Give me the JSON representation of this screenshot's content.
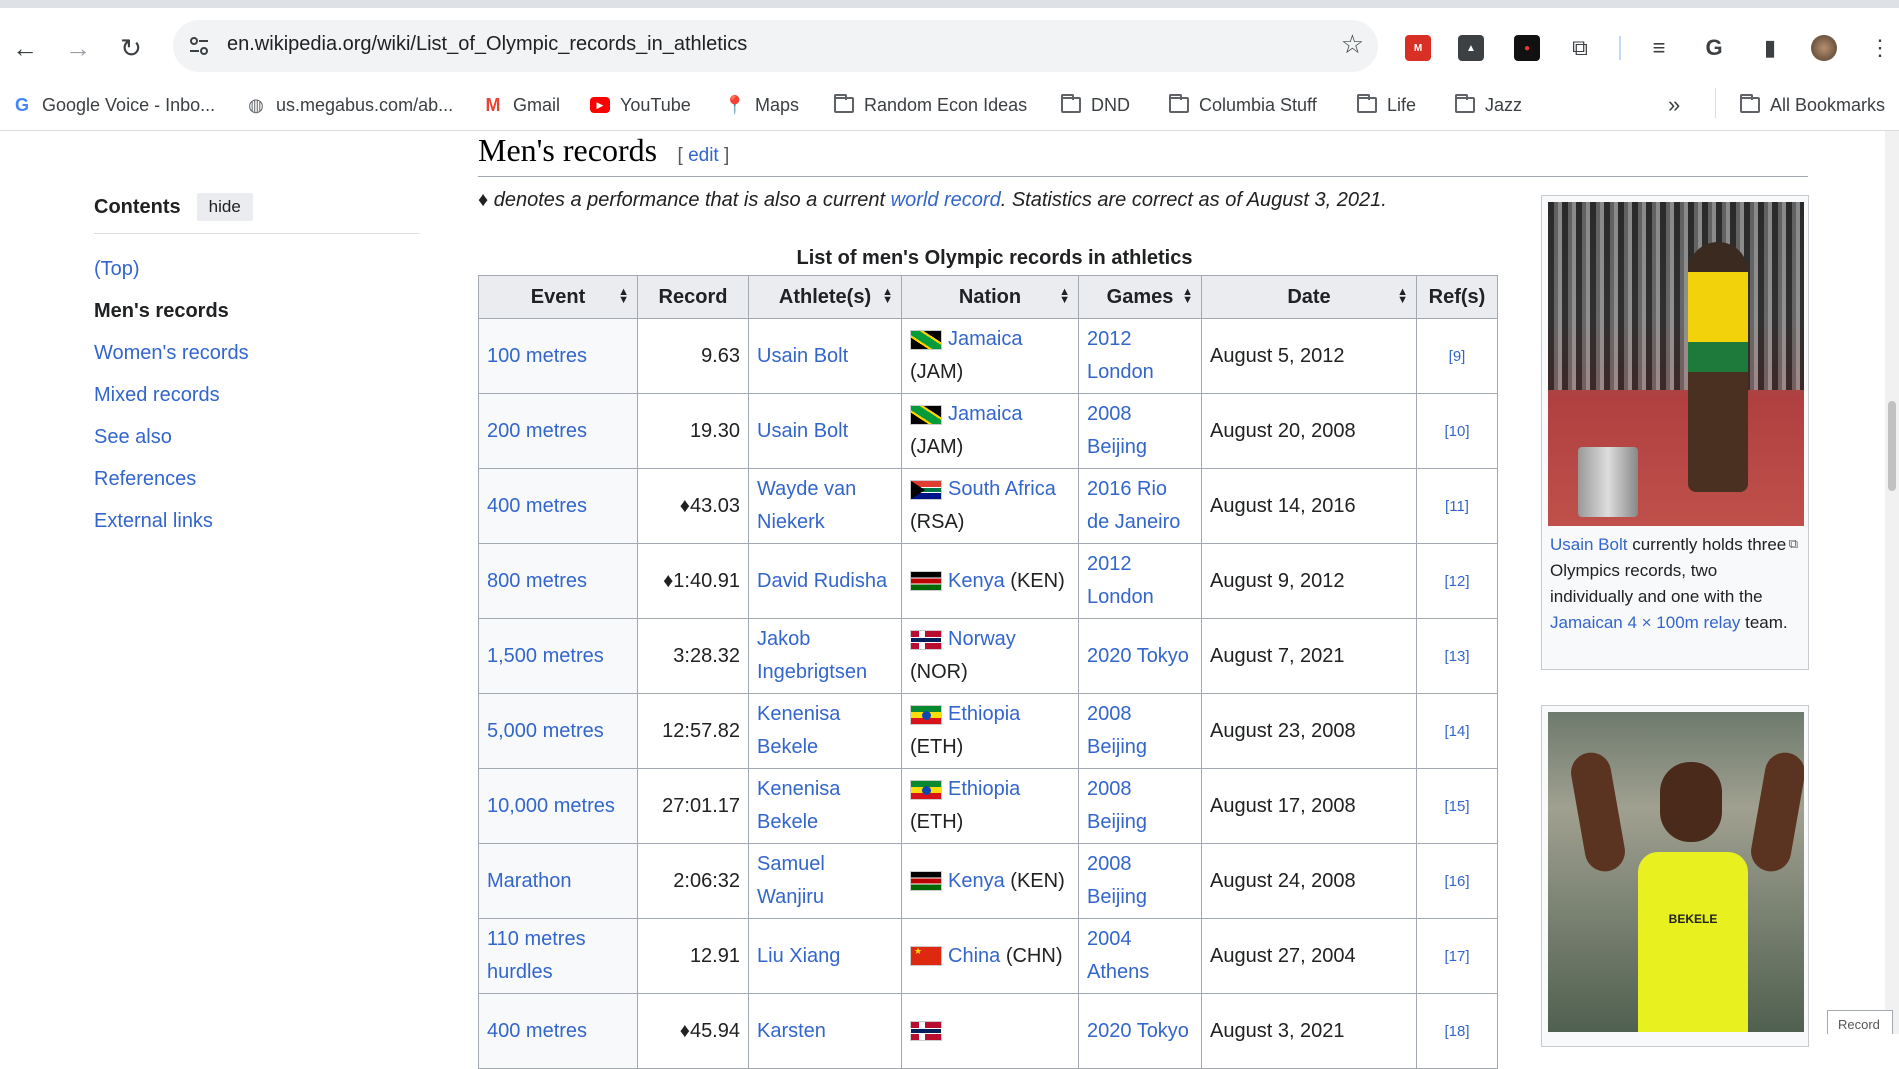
{
  "browser": {
    "url": "en.wikipedia.org/wiki/List_of_Olympic_records_in_athletics",
    "bookmarks": [
      {
        "label": "Google Voice - Inbo...",
        "icon": "google-icon"
      },
      {
        "label": "us.megabus.com/ab...",
        "icon": "globe-icon"
      },
      {
        "label": "Gmail",
        "icon": "gmail-icon"
      },
      {
        "label": "YouTube",
        "icon": "youtube-icon"
      },
      {
        "label": "Maps",
        "icon": "maps-icon"
      },
      {
        "label": "Random Econ Ideas",
        "icon": "folder-icon"
      },
      {
        "label": "DND",
        "icon": "folder-icon"
      },
      {
        "label": "Columbia Stuff",
        "icon": "folder-icon"
      },
      {
        "label": "Life",
        "icon": "folder-icon"
      },
      {
        "label": "Jazz",
        "icon": "folder-icon"
      }
    ],
    "more_bookmarks": "»",
    "all_bookmarks": "All Bookmarks"
  },
  "toc": {
    "title": "Contents",
    "hide": "hide",
    "items": [
      "(Top)",
      "Men's records",
      "Women's records",
      "Mixed records",
      "See also",
      "References",
      "External links"
    ],
    "active_index": 1
  },
  "section": {
    "title": "Men's records",
    "edit_open": "[ ",
    "edit": "edit",
    "edit_close": " ]",
    "note_prefix": "♦ denotes a performance that is also a current ",
    "note_link": "world record",
    "note_suffix": ". Statistics are correct as of August 3, 2021."
  },
  "table": {
    "caption": "List of men's Olympic records in athletics",
    "headers": [
      "Event",
      "Record",
      "Athlete(s)",
      "Nation",
      "Games",
      "Date",
      "Ref(s)"
    ],
    "rows": [
      {
        "event": "100 metres",
        "record": "9.63",
        "athlete": "Usain Bolt",
        "flag": "jam",
        "nation": "Jamaica",
        "code": "(JAM)",
        "games": "2012 London",
        "date": "August 5, 2012",
        "ref": "[9]"
      },
      {
        "event": "200 metres",
        "record": "19.30",
        "athlete": "Usain Bolt",
        "flag": "jam",
        "nation": "Jamaica",
        "code": "(JAM)",
        "games": "2008 Beijing",
        "date": "August 20, 2008",
        "ref": "[10]"
      },
      {
        "event": "400 metres",
        "record": "♦43.03",
        "athlete": "Wayde van Niekerk",
        "flag": "rsa",
        "nation": "South Africa",
        "code": "(RSA)",
        "games": "2016 Rio de Janeiro",
        "date": "August 14, 2016",
        "ref": "[11]"
      },
      {
        "event": "800 metres",
        "record": "♦1:40.91",
        "athlete": "David Rudisha",
        "flag": "ken",
        "nation": "Kenya",
        "code": "(KEN)",
        "games": "2012 London",
        "date": "August 9, 2012",
        "ref": "[12]"
      },
      {
        "event": "1,500 metres",
        "record": "3:28.32",
        "athlete": "Jakob Ingebrigtsen",
        "flag": "nor",
        "nation": "Norway",
        "code": "(NOR)",
        "games": "2020 Tokyo",
        "date": "August 7, 2021",
        "ref": "[13]"
      },
      {
        "event": "5,000 metres",
        "record": "12:57.82",
        "athlete": "Kenenisa Bekele",
        "flag": "eth",
        "nation": "Ethiopia",
        "code": "(ETH)",
        "games": "2008 Beijing",
        "date": "August 23, 2008",
        "ref": "[14]"
      },
      {
        "event": "10,000 metres",
        "record": "27:01.17",
        "athlete": "Kenenisa Bekele",
        "flag": "eth",
        "nation": "Ethiopia",
        "code": "(ETH)",
        "games": "2008 Beijing",
        "date": "August 17, 2008",
        "ref": "[15]"
      },
      {
        "event": "Marathon",
        "record": "2:06:32",
        "athlete": "Samuel Wanjiru",
        "flag": "ken",
        "nation": "Kenya",
        "code": "(KEN)",
        "games": "2008 Beijing",
        "date": "August 24, 2008",
        "ref": "[16]"
      },
      {
        "event": "110 metres hurdles",
        "record": "12.91",
        "athlete": "Liu Xiang",
        "flag": "chn",
        "nation": "China",
        "code": "(CHN)",
        "games": "2004 Athens",
        "date": "August 27, 2004",
        "ref": "[17]"
      },
      {
        "event": "400 metres",
        "record": "♦45.94",
        "athlete": "Karsten",
        "flag": "nor",
        "nation": "",
        "code": "",
        "games": "2020 Tokyo",
        "date": "August 3, 2021",
        "ref": "[18]"
      }
    ]
  },
  "infobox1": {
    "caption_link1": "Usain Bolt",
    "caption_text1": " currently holds three Olympics records, two individually and one with the ",
    "caption_link2": "Jamaican 4 × 100m relay",
    "caption_text2": " team."
  },
  "infobox2": {
    "bib": "BEKELE"
  },
  "record_button": "Record"
}
